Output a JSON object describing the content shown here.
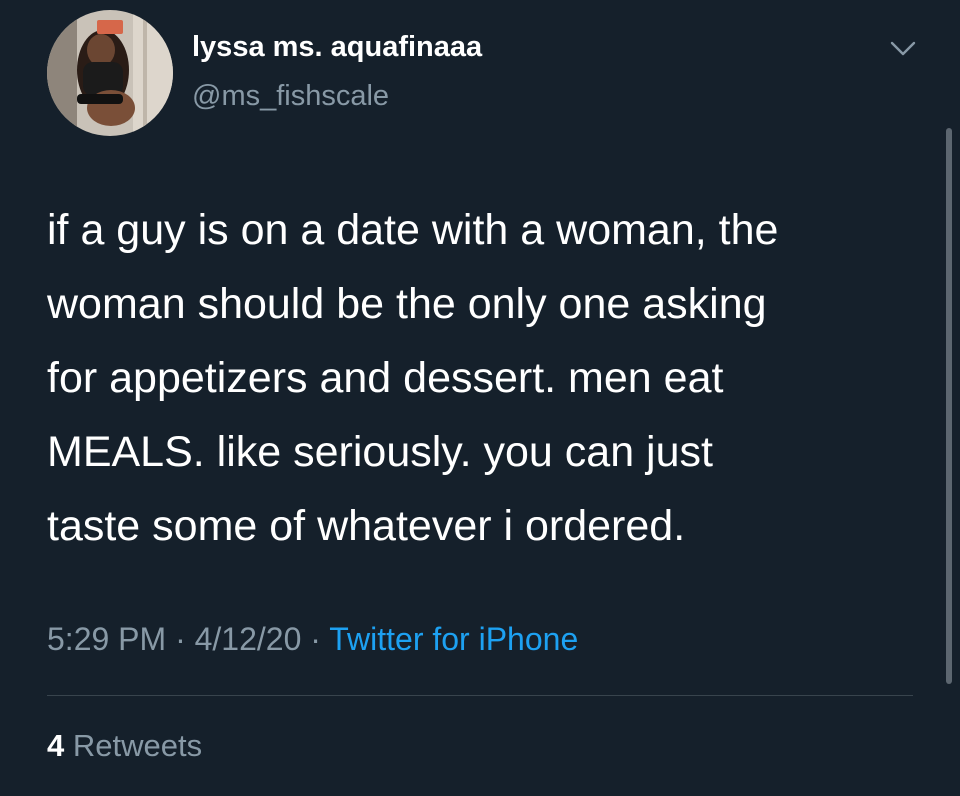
{
  "author": {
    "display_name": "lyssa ms. aquafinaaa",
    "handle": "@ms_fishscale"
  },
  "tweet": {
    "text_lines": [
      "if a guy is on a date with a woman, the",
      "woman should be the only one asking",
      "for appetizers and dessert. men eat",
      "MEALS. like seriously. you can just",
      "taste some of whatever i ordered."
    ]
  },
  "meta": {
    "time": "5:29 PM",
    "date": "4/12/20",
    "separator": "·",
    "source": "Twitter for iPhone"
  },
  "stats": {
    "retweets_count": "4",
    "retweets_label": "Retweets"
  },
  "icons": {
    "menu": "chevron-down-icon"
  },
  "colors": {
    "background": "#15202b",
    "primary_text": "#ffffff",
    "secondary_text": "#8899a6",
    "accent": "#1da1f2",
    "divider": "#38444d"
  }
}
